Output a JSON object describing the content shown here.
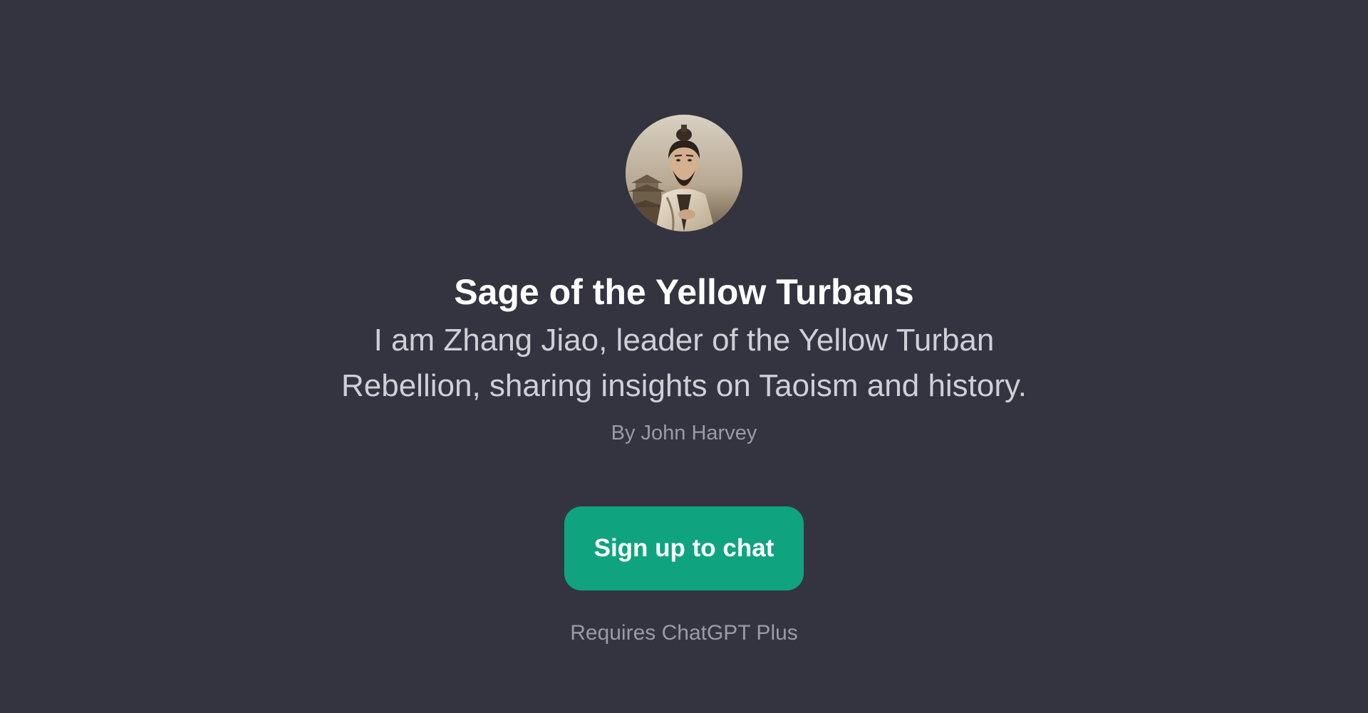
{
  "gpt": {
    "title": "Sage of the Yellow Turbans",
    "description_lines": [
      "I am Zhang Jiao, leader of the Yellow Turban",
      "Rebellion, sharing insights on Taoism and history."
    ],
    "author": "By John Harvey",
    "avatar_icon": "sage-portrait-avatar"
  },
  "cta": {
    "signup_label": "Sign up to chat",
    "requirement": "Requires ChatGPT Plus"
  },
  "colors": {
    "background": "#343441",
    "accent": "#10a37f",
    "title_text": "#ffffff",
    "description_text": "#cfcfd6",
    "muted_text": "#9b9ba6"
  }
}
